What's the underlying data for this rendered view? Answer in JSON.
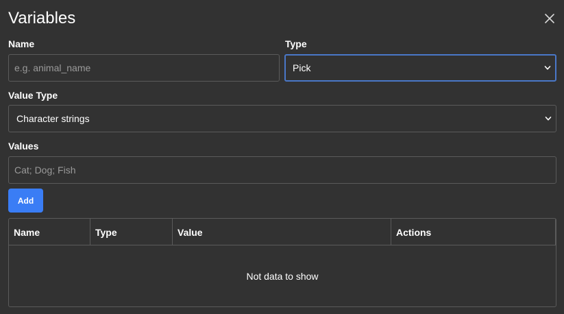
{
  "dialog": {
    "title": "Variables"
  },
  "form": {
    "name_label": "Name",
    "name_placeholder": "e.g. animal_name",
    "type_label": "Type",
    "type_value": "Pick",
    "value_type_label": "Value Type",
    "value_type_value": "Character strings",
    "values_label": "Values",
    "values_placeholder": "Cat; Dog; Fish",
    "add_label": "Add"
  },
  "table": {
    "columns": [
      "Name",
      "Type",
      "Value",
      "Actions"
    ],
    "empty_message": "Not data to show"
  },
  "colors": {
    "background": "#323232",
    "border": "#5b5b5b",
    "accent": "#3a7df5",
    "focus": "#4a78c9"
  },
  "icons": {
    "close": "close-icon",
    "dropdown": "chevron-down-icon"
  }
}
